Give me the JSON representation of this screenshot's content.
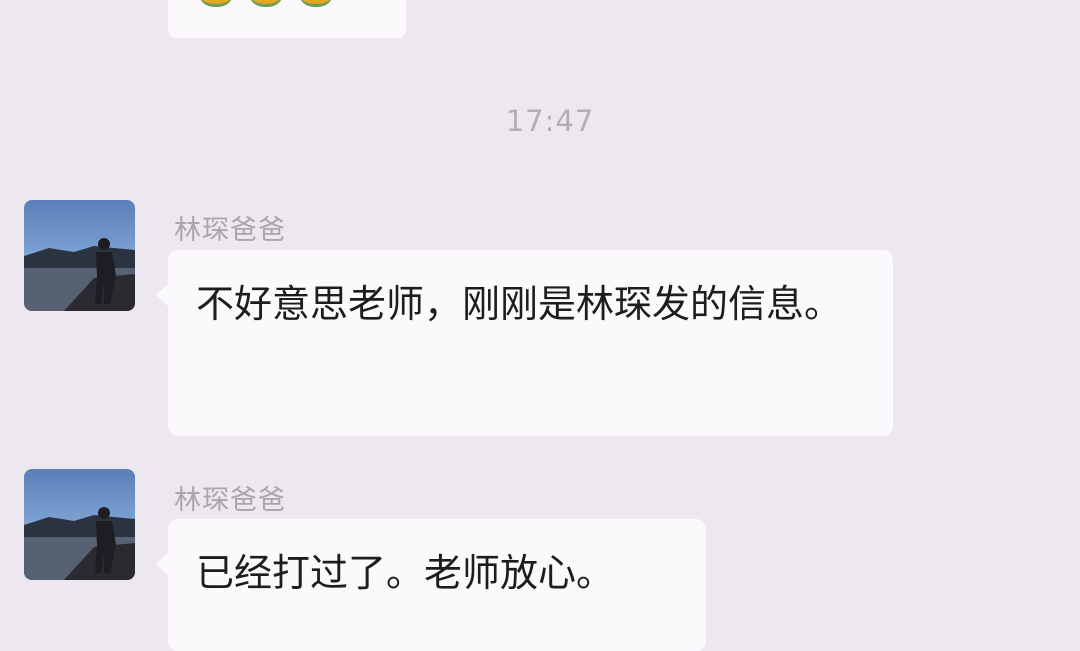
{
  "chat": {
    "timestamp": "17:47",
    "messages": [
      {
        "sender": "林琛爸爸",
        "text": "不好意思老师，刚刚是林琛发的信息。"
      },
      {
        "sender": "林琛爸爸",
        "text": "已经打过了。老师放心。"
      }
    ]
  },
  "icons": {
    "avatar": "person-by-lake-photo",
    "previous_message": "emoji-sticker"
  }
}
